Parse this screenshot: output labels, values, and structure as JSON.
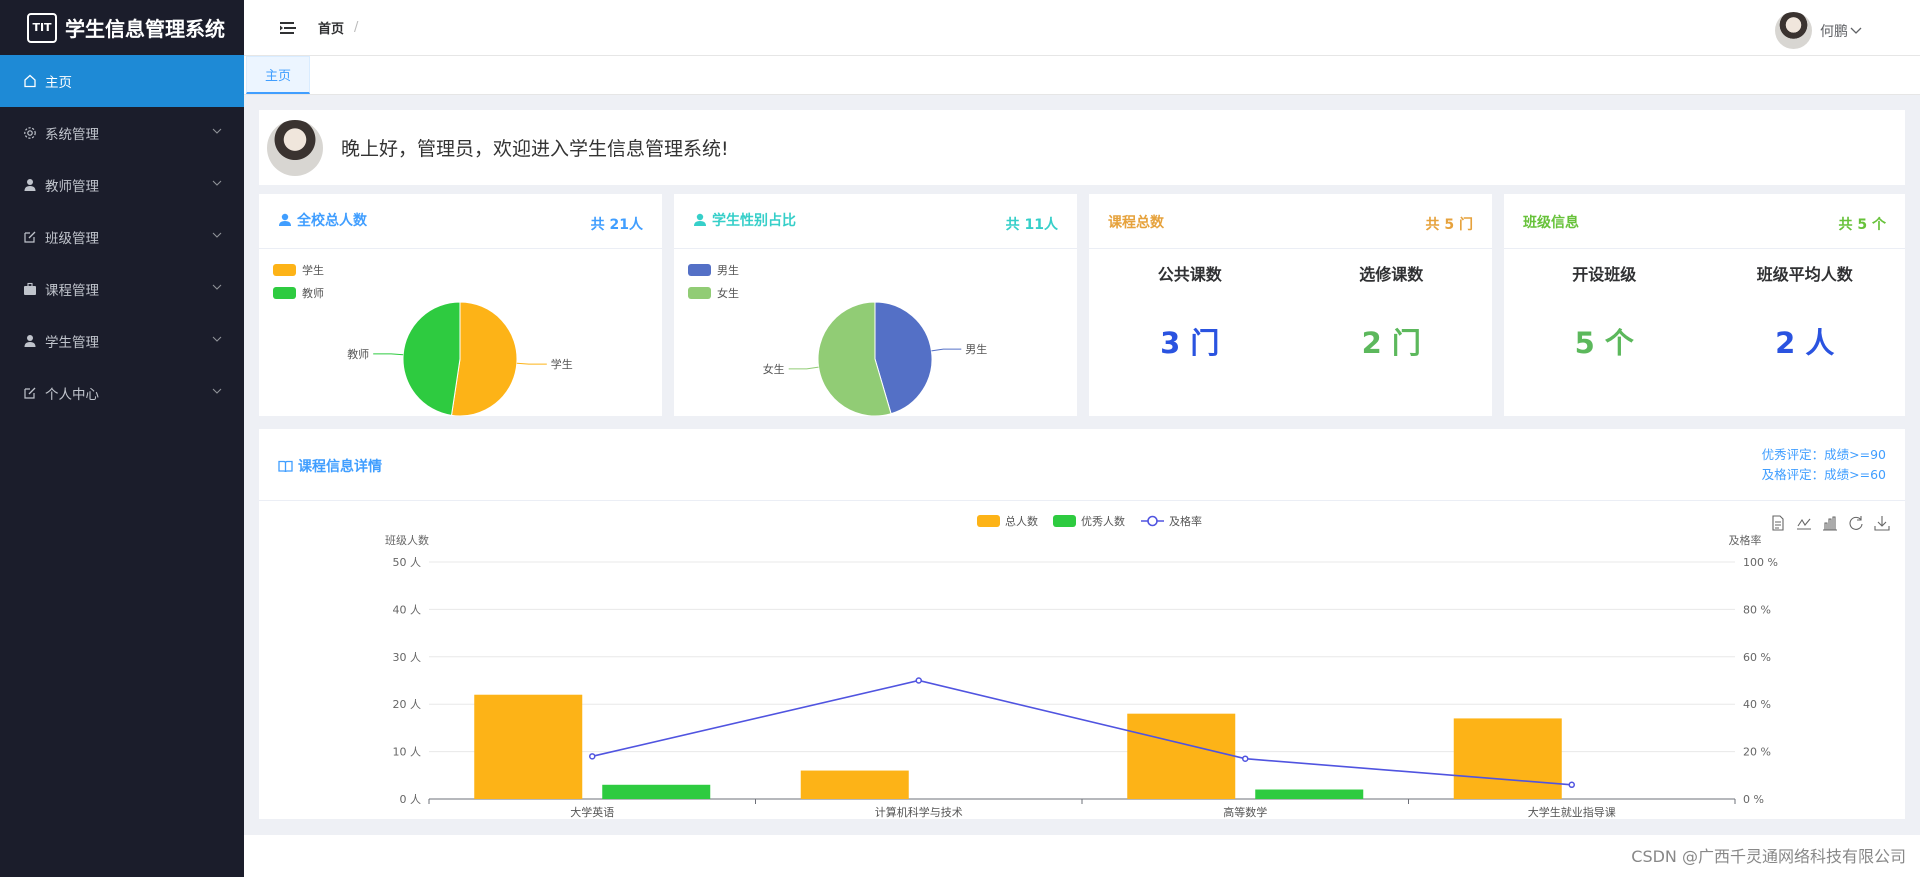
{
  "app": {
    "title": "学生信息管理系统",
    "logo_text": "TIT"
  },
  "sidebar": {
    "items": [
      {
        "label": "主页",
        "icon": "home-icon",
        "active": true
      },
      {
        "label": "系统管理",
        "icon": "gear-icon"
      },
      {
        "label": "教师管理",
        "icon": "user-icon"
      },
      {
        "label": "班级管理",
        "icon": "edit-icon"
      },
      {
        "label": "课程管理",
        "icon": "briefcase-icon"
      },
      {
        "label": "学生管理",
        "icon": "user-icon"
      },
      {
        "label": "个人中心",
        "icon": "edit-icon"
      }
    ]
  },
  "header": {
    "breadcrumb": "首页",
    "separator": "/",
    "user_name": "何鹏"
  },
  "tabs": {
    "home": "主页"
  },
  "welcome": {
    "text": "晚上好，管理员，欢迎进入学生信息管理系统!"
  },
  "cards": {
    "total": {
      "title": "全校总人数",
      "total": "共 21人",
      "legend": [
        "学生",
        "教师"
      ],
      "labels": {
        "student": "学生",
        "teacher": "教师"
      }
    },
    "gender": {
      "title": "学生性别占比",
      "total": "共 11人",
      "legend": [
        "男生",
        "女生"
      ],
      "labels": {
        "male": "男生",
        "female": "女生"
      }
    },
    "courses": {
      "title": "课程总数",
      "total": "共 5 门",
      "col1_label": "公共课数",
      "col1_value": "3 门",
      "col2_label": "选修课数",
      "col2_value": "2 门"
    },
    "classes": {
      "title": "班级信息",
      "total": "共 5 个",
      "col1_label": "开设班级",
      "col1_value": "5 个",
      "col2_label": "班级平均人数",
      "col2_value": "2 人"
    }
  },
  "course_detail": {
    "title": "课程信息详情",
    "note_excellent": "优秀评定：成绩>=90",
    "note_pass": "及格评定：成绩>=60"
  },
  "colors": {
    "blue": "#409eff",
    "cyan": "#36cfc9",
    "orange": "#e6a23c",
    "green": "#67c23a",
    "bar_orange": "#fdb317",
    "bar_green": "#2ecb40",
    "line": "#5054e0",
    "pie_blue": "#5470c6",
    "pie_lightgreen": "#91cc75"
  },
  "watermark": "CSDN @广西千灵通网络科技有限公司",
  "chart_data": [
    {
      "type": "pie",
      "categories": [
        "学生",
        "教师"
      ],
      "values": [
        11,
        10
      ]
    },
    {
      "type": "pie",
      "categories": [
        "男生",
        "女生"
      ],
      "values": [
        5,
        6
      ]
    },
    {
      "type": "bar",
      "categories": [
        "大学英语",
        "计算机科学与技术",
        "高等数学",
        "大学生就业指导课"
      ],
      "series": [
        {
          "name": "总人数",
          "type": "bar",
          "values": [
            22,
            6,
            18,
            17
          ]
        },
        {
          "name": "优秀人数",
          "type": "bar",
          "values": [
            3,
            0,
            2,
            0
          ]
        },
        {
          "name": "及格率",
          "type": "line",
          "axis": "right",
          "values": [
            18,
            50,
            17,
            6
          ]
        }
      ],
      "ylabel": "班级人数",
      "ylabel_right": "及格率",
      "ylim": [
        0,
        50
      ],
      "ylim_right": [
        0,
        100
      ],
      "yticks": [
        "0 人",
        "10 人",
        "20 人",
        "30 人",
        "40 人",
        "50 人"
      ],
      "yticks_right": [
        "0 %",
        "20 %",
        "40 %",
        "60 %",
        "80 %",
        "100 %"
      ],
      "grid": true,
      "legend": "top-center"
    }
  ]
}
